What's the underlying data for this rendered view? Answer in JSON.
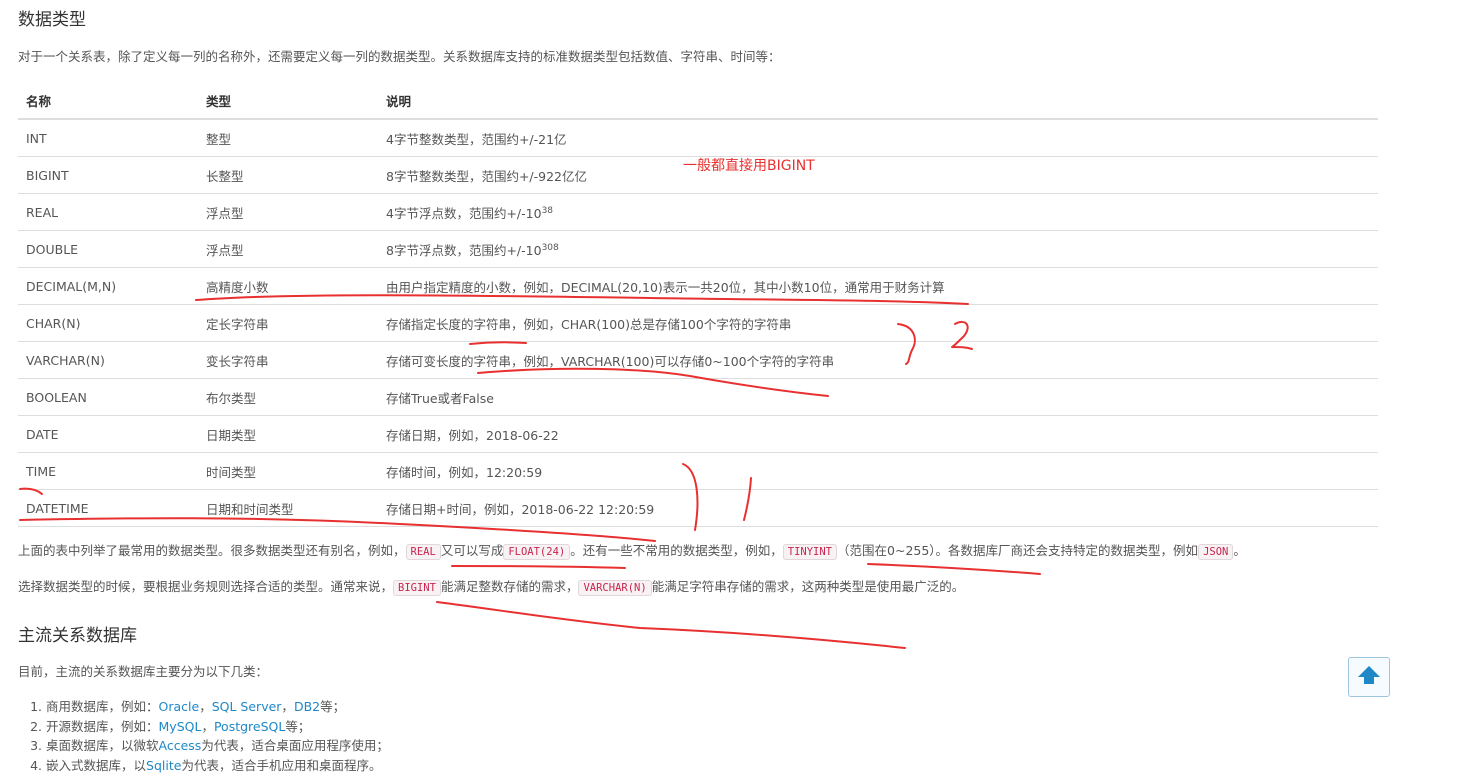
{
  "section1": {
    "title": "数据类型",
    "intro": "对于一个关系表，除了定义每一列的名称外，还需要定义每一列的数据类型。关系数据库支持的标准数据类型包括数值、字符串、时间等："
  },
  "table": {
    "headers": [
      "名称",
      "类型",
      "说明"
    ],
    "rows": [
      {
        "name": "INT",
        "type": "整型",
        "desc": "4字节整数类型，范围约+/-21亿"
      },
      {
        "name": "BIGINT",
        "type": "长整型",
        "desc": "8字节整数类型，范围约+/-922亿亿"
      },
      {
        "name": "REAL",
        "type": "浮点型",
        "desc": "4字节浮点数，范围约+/-10",
        "sup": "38"
      },
      {
        "name": "DOUBLE",
        "type": "浮点型",
        "desc": "8字节浮点数，范围约+/-10",
        "sup": "308"
      },
      {
        "name": "DECIMAL(M,N)",
        "type": "高精度小数",
        "desc": "由用户指定精度的小数，例如，DECIMAL(20,10)表示一共20位，其中小数10位，通常用于财务计算"
      },
      {
        "name": "CHAR(N)",
        "type": "定长字符串",
        "desc": "存储指定长度的字符串，例如，CHAR(100)总是存储100个字符的字符串"
      },
      {
        "name": "VARCHAR(N)",
        "type": "变长字符串",
        "desc": "存储可变长度的字符串，例如，VARCHAR(100)可以存储0~100个字符的字符串"
      },
      {
        "name": "BOOLEAN",
        "type": "布尔类型",
        "desc": "存储True或者False"
      },
      {
        "name": "DATE",
        "type": "日期类型",
        "desc": "存储日期，例如，2018-06-22"
      },
      {
        "name": "TIME",
        "type": "时间类型",
        "desc": "存储时间，例如，12:20:59"
      },
      {
        "name": "DATETIME",
        "type": "日期和时间类型",
        "desc": "存储日期+时间，例如，2018-06-22 12:20:59"
      }
    ]
  },
  "alias_para": {
    "t1": "上面的表中列举了最常用的数据类型。很多数据类型还有别名，例如，",
    "c1": "REAL",
    "t2": "又可以写成",
    "c2": "FLOAT(24)",
    "t3": "。还有一些不常用的数据类型，例如，",
    "c3": "TINYINT",
    "t4": "（范围在0~255）。各数据库厂商还会支持特定的数据类型，例如",
    "c4": "JSON",
    "t5": "。"
  },
  "choose_para": {
    "t1": "选择数据类型的时候，要根据业务规则选择合适的类型。通常来说，",
    "c1": "BIGINT",
    "t2": "能满足整数存储的需求，",
    "c2": "VARCHAR(N)",
    "t3": "能满足字符串存储的需求，这两种类型是使用最广泛的。"
  },
  "section2": {
    "title": "主流关系数据库",
    "intro": "目前，主流的关系数据库主要分为以下几类："
  },
  "list": {
    "i1": {
      "pre": "商用数据库，例如：",
      "l1": "Oracle",
      "s1": "，",
      "l2": "SQL Server",
      "s2": "，",
      "l3": "DB2",
      "post": "等；"
    },
    "i2": {
      "pre": "开源数据库，例如：",
      "l1": "MySQL",
      "s1": "，",
      "l2": "PostgreSQL",
      "post": "等；"
    },
    "i3": {
      "pre": "桌面数据库，以微软",
      "l1": "Access",
      "post": "为代表，适合桌面应用程序使用；"
    },
    "i4": {
      "pre": "嵌入式数据库，以",
      "l1": "Sqlite",
      "post": "为代表，适合手机应用和桌面程序。"
    }
  },
  "annotation": {
    "note": "一般都直接用BIGINT",
    "color": "#e83030"
  },
  "back_to_top": {
    "icon": "arrow-up-icon",
    "color": "#1e88c7"
  }
}
